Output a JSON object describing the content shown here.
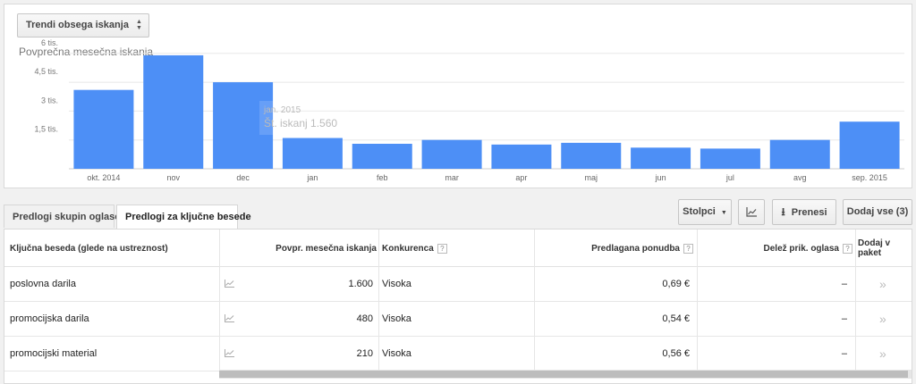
{
  "trend_selector": {
    "label": "Trendi obsega iskanja"
  },
  "chart_data": {
    "type": "bar",
    "title": "Povprečna mesečna iskanja",
    "categories": [
      "okt. 2014",
      "nov",
      "dec",
      "jan",
      "feb",
      "mar",
      "apr",
      "maj",
      "jun",
      "jul",
      "avg",
      "sep. 2015"
    ],
    "values": [
      4100,
      5900,
      4500,
      1600,
      1300,
      1500,
      1260,
      1350,
      1100,
      1050,
      1500,
      2450
    ],
    "ylim": [
      0,
      6500
    ],
    "yticks": [
      {
        "value": 1500,
        "label": "1,5 tis."
      },
      {
        "value": 3000,
        "label": "3 tis."
      },
      {
        "value": 4500,
        "label": "4,5 tis."
      },
      {
        "value": 6000,
        "label": "6 tis."
      }
    ],
    "bar_color": "#4d8ff6",
    "grid": true
  },
  "tooltip": {
    "line1": "jan. 2015",
    "line2": "Št. iskanj  1.560"
  },
  "tabs": [
    {
      "label": "Predlogi skupin oglasov",
      "active": false
    },
    {
      "label": "Predlogi za ključne besede",
      "active": true
    }
  ],
  "toolbar": {
    "columns_label": "Stolpci",
    "download_label": "Prenesi",
    "add_all_label": "Dodaj vse (3)"
  },
  "table": {
    "headers": {
      "keyword": "Ključna beseda (glede na ustreznost)",
      "searches": "Povpr. mesečna iskanja",
      "competition": "Konkurenca",
      "bid": "Predlagana ponudba",
      "share": "Delež prik. oglasa",
      "add_line1": "Dodaj v",
      "add_line2": "paket"
    },
    "help_glyph": "?",
    "rows": [
      {
        "keyword": "poslovna darila",
        "searches": "1.600",
        "competition": "Visoka",
        "bid": "0,69 €",
        "share": "–",
        "add": "»"
      },
      {
        "keyword": "promocijska darila",
        "searches": "480",
        "competition": "Visoka",
        "bid": "0,54 €",
        "share": "–",
        "add": "»"
      },
      {
        "keyword": "promocijski material",
        "searches": "210",
        "competition": "Visoka",
        "bid": "0,56 €",
        "share": "–",
        "add": "»"
      }
    ]
  }
}
